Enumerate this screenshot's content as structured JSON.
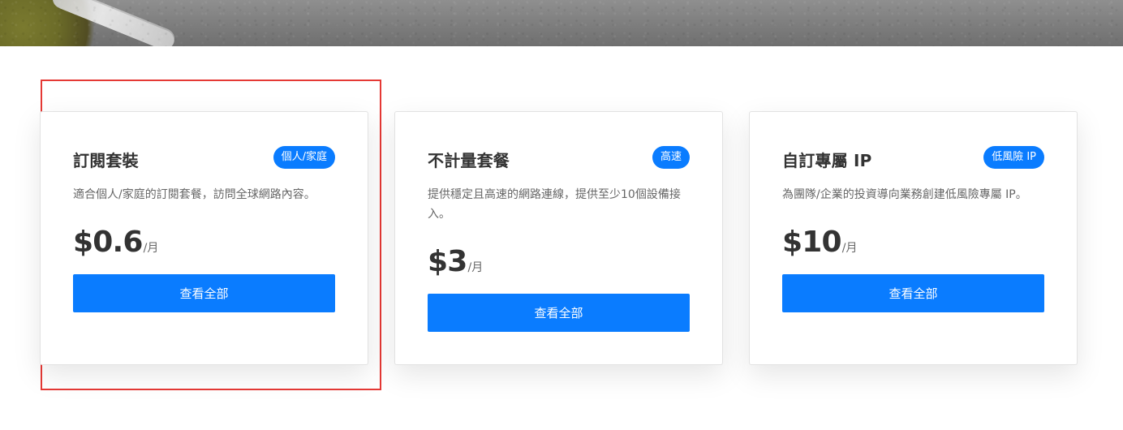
{
  "plans": [
    {
      "title": "訂閱套裝",
      "badge": "個人/家庭",
      "description": "適合個人/家庭的訂閱套餐，訪問全球網路內容。",
      "price": "$0.6",
      "unit": "/月",
      "cta": "查看全部"
    },
    {
      "title": "不計量套餐",
      "badge": "高速",
      "description": "提供穩定且高速的網路連線，提供至少10個設備接入。",
      "price": "$3",
      "unit": "/月",
      "cta": "查看全部"
    },
    {
      "title": "自訂專屬 IP",
      "badge": "低風險 IP",
      "description": "為團隊/企業的投資導向業務創建低風險專屬 IP。",
      "price": "$10",
      "unit": "/月",
      "cta": "查看全部"
    }
  ],
  "colors": {
    "accent": "#0a7cff",
    "highlight_outline": "#e53935",
    "text_primary": "#333333",
    "text_secondary": "#666666"
  }
}
